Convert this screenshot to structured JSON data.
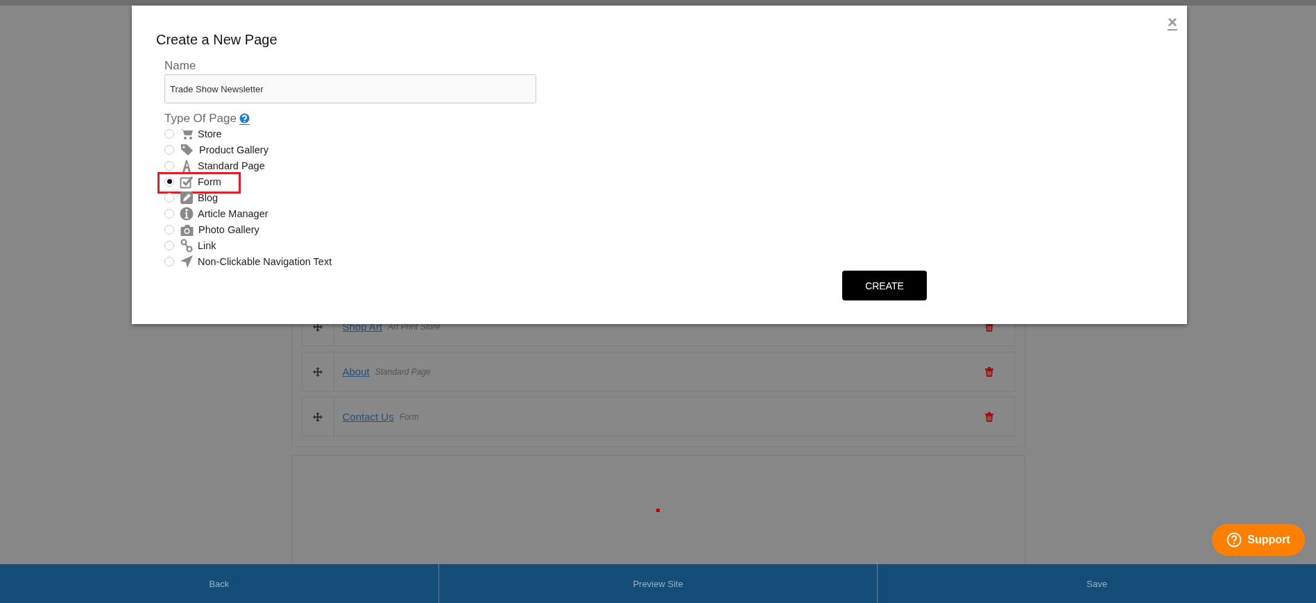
{
  "dialog": {
    "title": "Create a New Page",
    "close": "×",
    "name_label": "Name",
    "name_value": "Trade Show Newsletter",
    "type_label": "Type Of Page",
    "options": [
      {
        "label": "Store",
        "kind": "cart",
        "selected": false,
        "highlighted": false
      },
      {
        "label": "Product Gallery",
        "kind": "tags",
        "selected": false,
        "highlighted": false
      },
      {
        "label": "Standard Page",
        "kind": "font",
        "selected": false,
        "highlighted": false
      },
      {
        "label": "Form",
        "kind": "check",
        "selected": true,
        "highlighted": true
      },
      {
        "label": "Blog",
        "kind": "pencil",
        "selected": false,
        "highlighted": false
      },
      {
        "label": "Article Manager",
        "kind": "info",
        "selected": false,
        "highlighted": false
      },
      {
        "label": "Photo Gallery",
        "kind": "camera",
        "selected": false,
        "highlighted": false
      },
      {
        "label": "Link",
        "kind": "link",
        "selected": false,
        "highlighted": false
      },
      {
        "label": "Non-Clickable Navigation Text",
        "kind": "arrow",
        "selected": false,
        "highlighted": false
      }
    ],
    "create_button": "CREATE"
  },
  "pages": [
    {
      "title": "Shop Art",
      "type": "Art Print Store"
    },
    {
      "title": "About",
      "type": "Standard Page"
    },
    {
      "title": "Contact Us",
      "type": "Form"
    }
  ],
  "support_button": "Support",
  "footer": [
    "Back",
    "Preview Site",
    "Save"
  ]
}
